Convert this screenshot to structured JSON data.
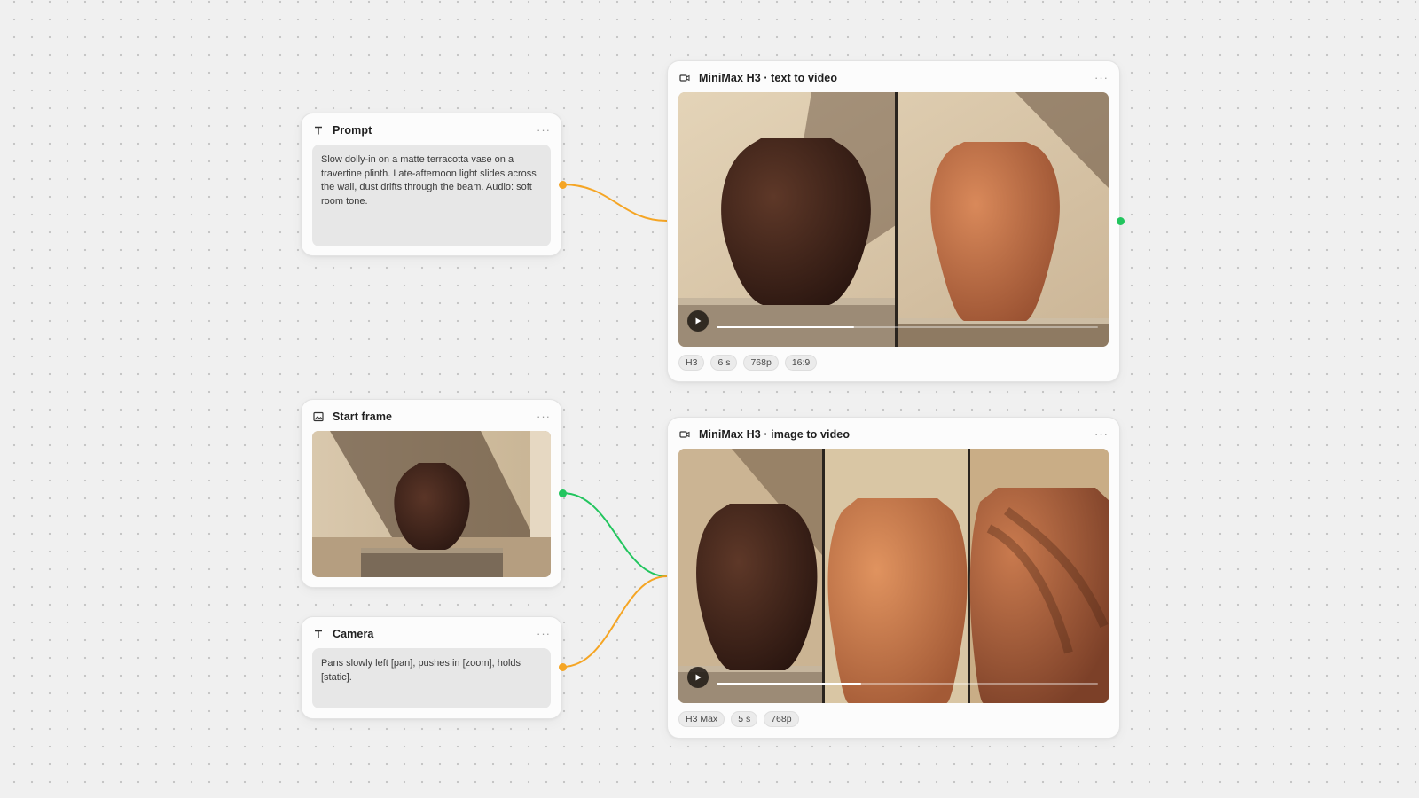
{
  "nodes": {
    "prompt": {
      "title": "Prompt",
      "icon": "text-icon",
      "text": "Slow dolly-in on a matte terracotta vase on a travertine plinth. Late-afternoon light slides across the wall, dust drifts through the beam. Audio: soft room tone."
    },
    "start_frame": {
      "title": "Start frame",
      "icon": "image-icon"
    },
    "camera": {
      "title": "Camera",
      "icon": "text-icon",
      "text": "Pans slowly left [pan], pushes in [zoom], holds [static]."
    },
    "t2v": {
      "title": "MiniMax H3 · text to video",
      "icon": "video-icon",
      "progress": 0.36,
      "tags": [
        "H3",
        "6 s",
        "768p",
        "16:9"
      ]
    },
    "i2v": {
      "title": "MiniMax H3 · image to video",
      "icon": "video-icon",
      "progress": 0.38,
      "tags": [
        "H3 Max",
        "5 s",
        "768p"
      ]
    }
  },
  "more_label": "···",
  "colors": {
    "text_wire": "#f5a524",
    "image_wire": "#22c55e",
    "terracotta": "#c97a4e",
    "dark_clay": "#4a2b1f"
  }
}
